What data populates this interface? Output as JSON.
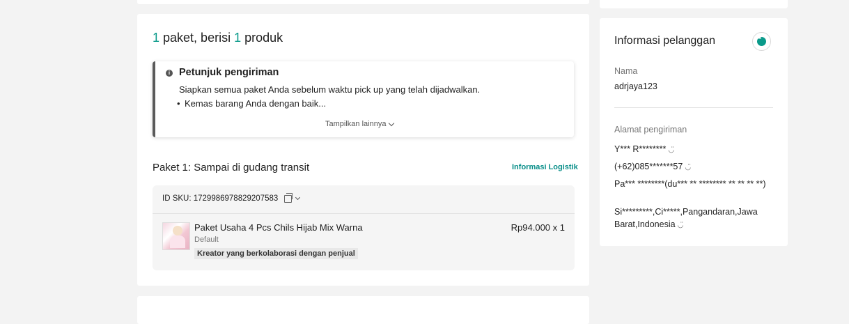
{
  "package": {
    "count": "1",
    "label_mid": " paket, berisi ",
    "product_count": "1",
    "label_end": " produk"
  },
  "hint": {
    "title": "Petunjuk pengiriman",
    "text": "Siapkan semua paket Anda sebelum waktu pick up yang telah dijadwalkan.",
    "bullet": "Kemas barang Anda dengan baik...",
    "show_more": "Tampilkan lainnya"
  },
  "shipment": {
    "status": "Paket 1: Sampai di gudang transit",
    "logistics_link": "Informasi Logistik",
    "sku": "ID SKU: 1729986978829207583",
    "product_name": "Paket Usaha 4 Pcs Chils Hijab Mix Warna",
    "variant": "Default",
    "tag": "Kreator yang berkolaborasi dengan penjual",
    "price": "Rp94.000 x 1"
  },
  "customer": {
    "title": "Informasi pelanggan",
    "name_label": "Nama",
    "name_value": "adrjaya123",
    "address_label": "Alamat pengiriman",
    "recipient": "Y*** R********",
    "phone": "(+62)085*******57",
    "address_line": "Pa*** ********(du*** ** ******** ** ** ** **)",
    "region": "Si*********,Ci*****,Pangandaran,Jawa Barat,Indonesia",
    "eye_icon": "eye-closed-icon"
  },
  "colors": {
    "accent": "#0a9a8a",
    "background": "#f3f3f3"
  }
}
